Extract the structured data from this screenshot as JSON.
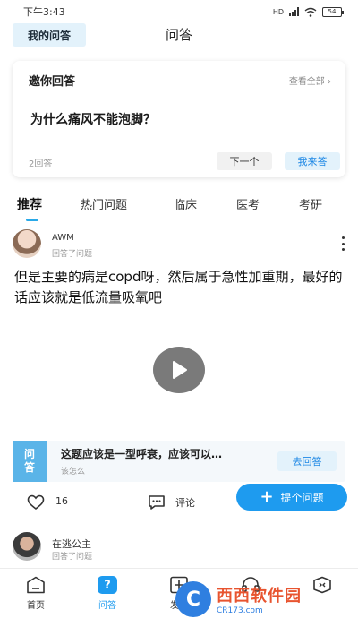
{
  "status_bar": {
    "time": "下午3:43",
    "network": "HD",
    "battery": "54"
  },
  "header": {
    "my_qa": "我的问答",
    "title": "问答"
  },
  "invite": {
    "title": "邀你回答",
    "view_all": "查看全部",
    "question": "为什么痛风不能泡脚？",
    "answer_count": "2回答",
    "next": "下一个",
    "answer": "我来答"
  },
  "tabs": [
    {
      "label": "推荐",
      "active": true
    },
    {
      "label": "热门问题",
      "active": false
    },
    {
      "label": "临床",
      "active": false
    },
    {
      "label": "医考",
      "active": false
    },
    {
      "label": "考研",
      "active": false
    }
  ],
  "post": {
    "author": "AWM",
    "action": "回答了问题",
    "content": "但是主要的病是copd呀，然后属于急性加重期，最好的话应该就是低流量吸氧吧",
    "related_icon_line1": "问",
    "related_icon_line2": "答",
    "related_question": "这题应该是一型呼衰，应该可以…",
    "related_sub": "该怎么",
    "go_answer": "去回答",
    "likes": "16",
    "comment_label": "评论",
    "ask_button": "提个问题"
  },
  "post2": {
    "author": "在逃公主",
    "action": "回答了问题"
  },
  "bottom_nav": [
    {
      "label": "首页",
      "icon": "home-icon",
      "active": false
    },
    {
      "label": "问答",
      "icon": "qa-icon",
      "active": true
    },
    {
      "label": "发布",
      "icon": "publish-icon",
      "active": false
    },
    {
      "label": "",
      "icon": "headset-icon",
      "active": false
    },
    {
      "label": "",
      "icon": "box-icon",
      "active": false
    }
  ],
  "watermark": {
    "logo_letter": "C",
    "main": "西西软件园",
    "sub": "CR173.com"
  },
  "colors": {
    "accent": "#1e9bef",
    "accent_light": "#e3f2fb",
    "tab_underline": "#29a9e8",
    "qa_icon_bg": "#5ab4e8"
  }
}
